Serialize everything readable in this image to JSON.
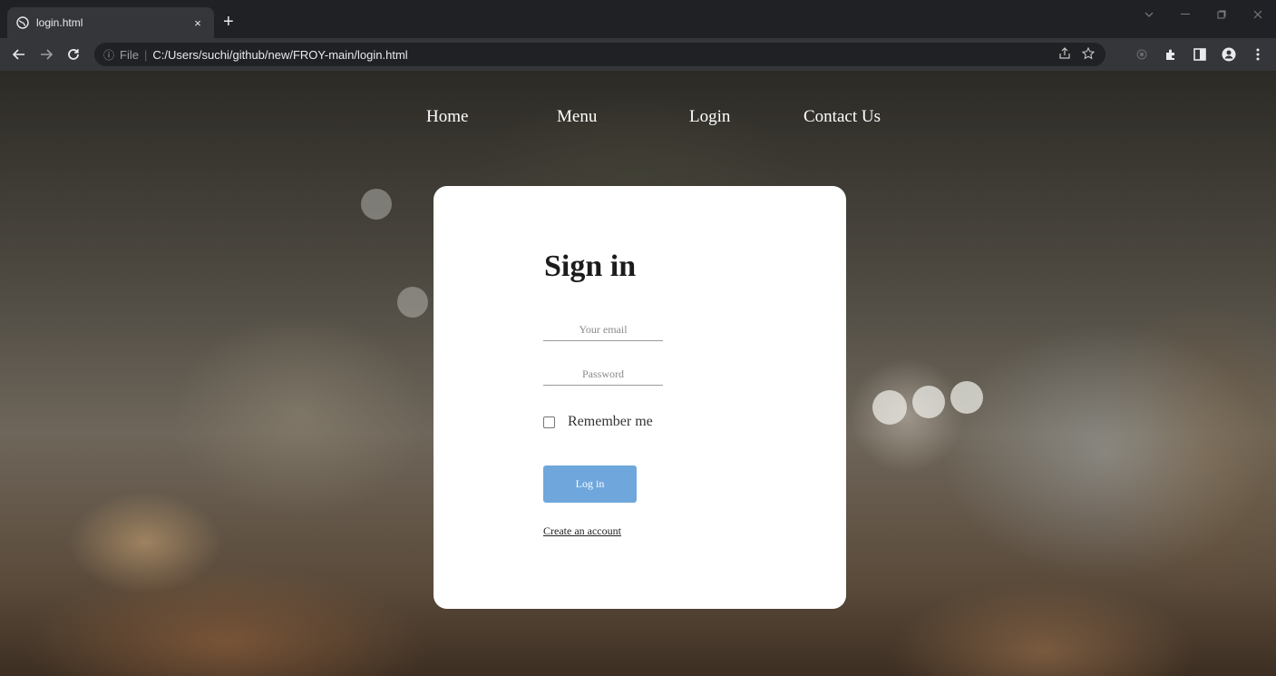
{
  "browser": {
    "tab_title": "login.html",
    "tab_close": "×",
    "new_tab": "+",
    "omnibox": {
      "info": "ⓘ",
      "scheme": "File",
      "separator": "|",
      "url": "C:/Users/suchi/github/new/FROY-main/login.html"
    },
    "icons": [
      "globe-icon",
      "share-icon",
      "star-icon",
      "extension-icon",
      "puzzle-icon",
      "side-panel-icon",
      "profile-icon",
      "more-icon"
    ]
  },
  "nav": {
    "home": "Home",
    "menu": "Menu",
    "login": "Login",
    "contact": "Contact Us"
  },
  "form": {
    "title": "Sign in",
    "email_placeholder": "Your email",
    "password_placeholder": "Password",
    "remember_label": "Remember me",
    "login_button": "Log in",
    "create_account": "Create an account"
  },
  "colors": {
    "button": "#6fa7dc",
    "card": "#ffffff",
    "chrome_dark": "#202124",
    "chrome_toolbar": "#35363a"
  }
}
